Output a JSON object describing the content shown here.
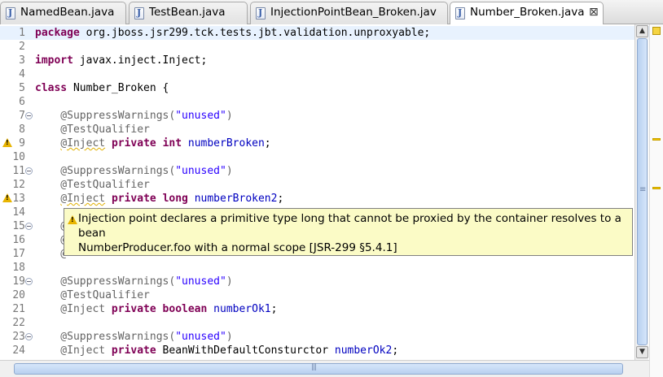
{
  "tabs": [
    {
      "label": "NamedBean.java",
      "active": false
    },
    {
      "label": "TestBean.java",
      "active": false
    },
    {
      "label": "InjectionPointBean_Broken.jav",
      "active": false
    },
    {
      "label": "Number_Broken.java",
      "active": true,
      "close": "⊠"
    }
  ],
  "editor": {
    "lines": [
      {
        "n": "1",
        "segs": [
          {
            "t": "package",
            "c": "kw"
          },
          {
            "t": " org.jboss.jsr299.tck.tests.jbt.validation.unproxyable;"
          }
        ]
      },
      {
        "n": "2",
        "segs": []
      },
      {
        "n": "3",
        "segs": [
          {
            "t": "import",
            "c": "kw"
          },
          {
            "t": " javax.inject.Inject;"
          }
        ]
      },
      {
        "n": "4",
        "segs": []
      },
      {
        "n": "5",
        "segs": [
          {
            "t": "class",
            "c": "kw"
          },
          {
            "t": " Number_Broken {"
          }
        ]
      },
      {
        "n": "6",
        "segs": []
      },
      {
        "n": "7",
        "fold": true,
        "segs": [
          {
            "t": "    @SuppressWarnings(",
            "c": "ann"
          },
          {
            "t": "\"unused\"",
            "c": "str"
          },
          {
            "t": ")",
            "c": "ann"
          }
        ]
      },
      {
        "n": "8",
        "segs": [
          {
            "t": "    @TestQualifier",
            "c": "ann"
          }
        ]
      },
      {
        "n": "9",
        "warn": true,
        "segs": [
          {
            "t": "    "
          },
          {
            "t": "@Inject",
            "c": "ann squig"
          },
          {
            "t": " "
          },
          {
            "t": "private",
            "c": "kw"
          },
          {
            "t": " "
          },
          {
            "t": "int",
            "c": "kw"
          },
          {
            "t": " "
          },
          {
            "t": "numberBroken",
            "c": "fld"
          },
          {
            "t": ";"
          }
        ]
      },
      {
        "n": "10",
        "segs": []
      },
      {
        "n": "11",
        "fold": true,
        "segs": [
          {
            "t": "    @SuppressWarnings(",
            "c": "ann"
          },
          {
            "t": "\"unused\"",
            "c": "str"
          },
          {
            "t": ")",
            "c": "ann"
          }
        ]
      },
      {
        "n": "12",
        "segs": [
          {
            "t": "    @TestQualifier",
            "c": "ann"
          }
        ]
      },
      {
        "n": "13",
        "warn": true,
        "segs": [
          {
            "t": "    "
          },
          {
            "t": "@Inject",
            "c": "ann squig"
          },
          {
            "t": " "
          },
          {
            "t": "private",
            "c": "kw"
          },
          {
            "t": " "
          },
          {
            "t": "long",
            "c": "kw"
          },
          {
            "t": " "
          },
          {
            "t": "numberBroken2",
            "c": "fld"
          },
          {
            "t": ";"
          }
        ]
      },
      {
        "n": "14",
        "segs": []
      },
      {
        "n": "15",
        "fold": true,
        "segs": [
          {
            "t": "    @",
            "c": "ann"
          }
        ]
      },
      {
        "n": "16",
        "segs": [
          {
            "t": "    @",
            "c": "ann"
          }
        ]
      },
      {
        "n": "17",
        "segs": [
          {
            "t": "    @",
            "c": "ann"
          }
        ]
      },
      {
        "n": "18",
        "segs": []
      },
      {
        "n": "19",
        "fold": true,
        "segs": [
          {
            "t": "    @SuppressWarnings(",
            "c": "ann"
          },
          {
            "t": "\"unused\"",
            "c": "str"
          },
          {
            "t": ")",
            "c": "ann"
          }
        ]
      },
      {
        "n": "20",
        "segs": [
          {
            "t": "    @TestQualifier",
            "c": "ann"
          }
        ]
      },
      {
        "n": "21",
        "segs": [
          {
            "t": "    @Inject",
            "c": "ann"
          },
          {
            "t": " "
          },
          {
            "t": "private",
            "c": "kw"
          },
          {
            "t": " "
          },
          {
            "t": "boolean",
            "c": "kw"
          },
          {
            "t": " "
          },
          {
            "t": "numberOk1",
            "c": "fld"
          },
          {
            "t": ";"
          }
        ]
      },
      {
        "n": "22",
        "segs": []
      },
      {
        "n": "23",
        "fold": true,
        "segs": [
          {
            "t": "    @SuppressWarnings(",
            "c": "ann"
          },
          {
            "t": "\"unused\"",
            "c": "str"
          },
          {
            "t": ")",
            "c": "ann"
          }
        ]
      },
      {
        "n": "24",
        "segs": [
          {
            "t": "    @Inject",
            "c": "ann"
          },
          {
            "t": " "
          },
          {
            "t": "private",
            "c": "kw"
          },
          {
            "t": " BeanWithDefaultConsturctor "
          },
          {
            "t": "numberOk2",
            "c": "fld"
          },
          {
            "t": ";"
          }
        ]
      }
    ]
  },
  "tooltip": {
    "line1": "Injection point declares a primitive type long that cannot be proxied by the container resolves to a bean",
    "line2": "NumberProducer.foo with a normal scope [JSR-299 §5.4.1]"
  },
  "scrollbar": {
    "up": "▲",
    "down": "▼"
  }
}
